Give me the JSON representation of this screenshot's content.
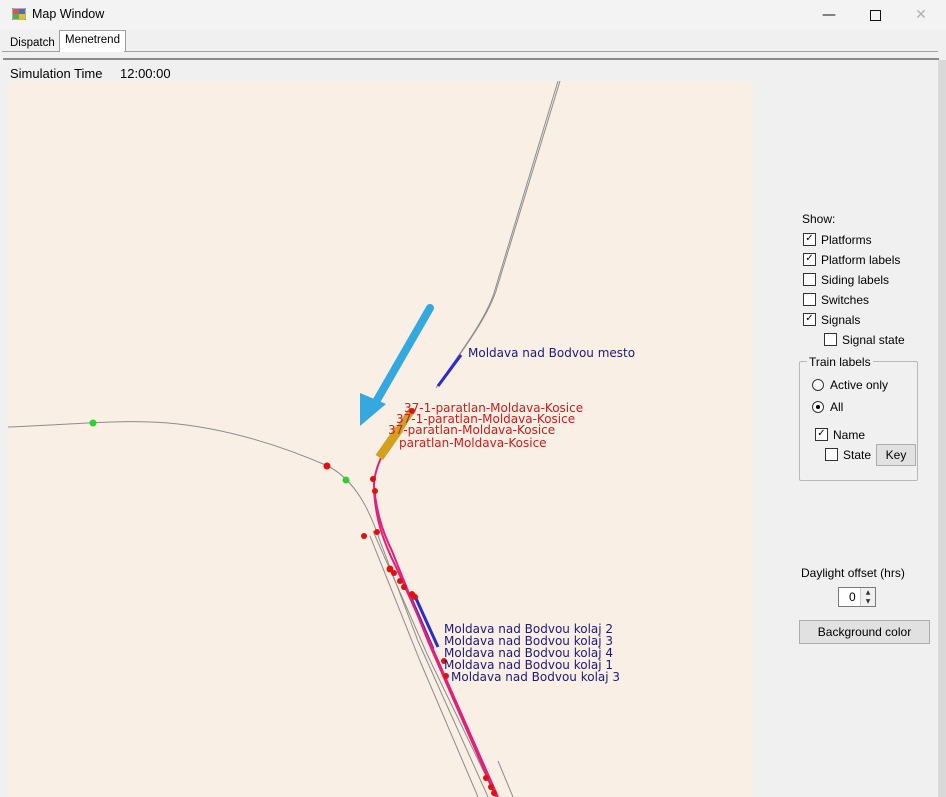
{
  "window": {
    "title": "Map Window",
    "minimize": "—",
    "close": "✕"
  },
  "tabs": [
    {
      "label": "Dispatch",
      "active": false
    },
    {
      "label": "Menetrend",
      "active": true
    }
  ],
  "simulation": {
    "label": "Simulation Time",
    "time": "12:00:00"
  },
  "map": {
    "background_color": "#faefe5",
    "platform_labels": [
      "Moldava nad Bodvou mesto",
      "Moldava nad Bodvou kolaj 2",
      "Moldava nad Bodvou kolaj 3",
      "Moldava nad Bodvou kolaj 4",
      "Moldava nad Bodvou kolaj 1",
      "Moldava nad Bodvou kolaj 3"
    ],
    "train_labels": [
      "37-1-paratlan-Moldava-Kosice",
      "37-1-paratlan-Moldava-Kosice",
      "37-paratlan-Moldava-Kosice",
      "paratlan-Moldava-Kosice"
    ],
    "colors": {
      "track": "#8c8c8c",
      "platform": "#2b2bd0",
      "route": "#e0207a",
      "signal_red": "#e01010",
      "signal_green": "#30d030",
      "train": "#d4a020",
      "arrow": "#35a8e0"
    }
  },
  "options": {
    "show_label": "Show:",
    "checkboxes": [
      {
        "label": "Platforms",
        "checked": true
      },
      {
        "label": "Platform labels",
        "checked": true
      },
      {
        "label": "Siding labels",
        "checked": false
      },
      {
        "label": "Switches",
        "checked": false
      },
      {
        "label": "Signals",
        "checked": true
      },
      {
        "label": "Signal state",
        "checked": false
      }
    ],
    "train_labels": {
      "title": "Train labels",
      "active_only": "Active only",
      "all": "All",
      "selected": "All",
      "name": "Name",
      "name_checked": true,
      "state": "State",
      "state_checked": false,
      "key_button": "Key"
    },
    "daylight": {
      "label": "Daylight offset (hrs)",
      "value": "0"
    },
    "background_button": "Background color"
  }
}
